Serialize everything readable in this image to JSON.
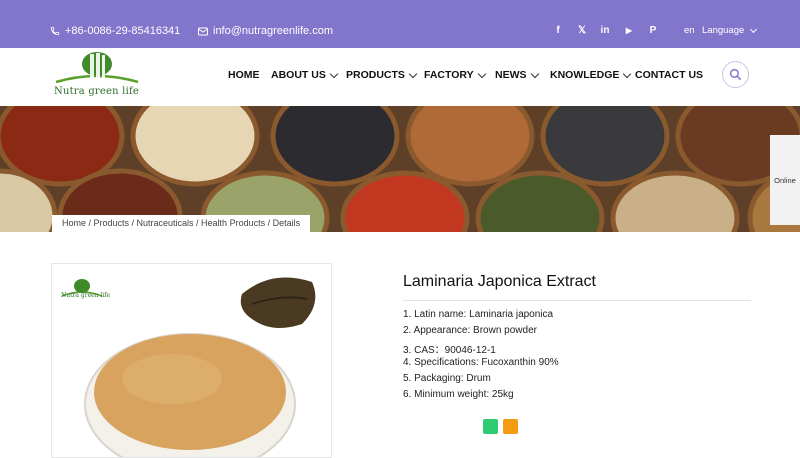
{
  "topbar": {
    "phone": "+86-0086-29-85416341",
    "email": "info@nutragreenlife.com",
    "socials": [
      {
        "name": "facebook-icon",
        "glyph": "f"
      },
      {
        "name": "x-icon",
        "glyph": "𝕏"
      },
      {
        "name": "linkedin-icon",
        "glyph": "in"
      },
      {
        "name": "youtube-icon",
        "glyph": "▶"
      },
      {
        "name": "pinterest-icon",
        "glyph": "P"
      }
    ],
    "lang_code": "en",
    "language_label": "Language",
    "bg_color": "#8275cc"
  },
  "logo": {
    "text": "Nutra green life"
  },
  "nav": {
    "items": [
      {
        "label": "HOME"
      },
      {
        "label": "ABOUT US"
      },
      {
        "label": "PRODUCTS"
      },
      {
        "label": "FACTORY"
      },
      {
        "label": "NEWS"
      },
      {
        "label": "KNOWLEDGE"
      },
      {
        "label": "CONTACT US"
      }
    ]
  },
  "breadcrumb": {
    "text": "Home / Products / Nutraceuticals / Health Products / Details"
  },
  "sidebar": {
    "online_label": "Online"
  },
  "product": {
    "title": "Laminaria Japonica Extract",
    "image_logo_text": "Nutra green life",
    "specs": [
      "1. Latin name: Laminaria japonica",
      "2. Appearance: Brown powder",
      "3. CAS：90046-12-1",
      "4. Specifications: Fucoxanthin 90%",
      "5. Packaging: Drum",
      "6. Minimum weight: 25kg"
    ],
    "share_colors": [
      "#2ecc71",
      "#f39c12"
    ]
  }
}
